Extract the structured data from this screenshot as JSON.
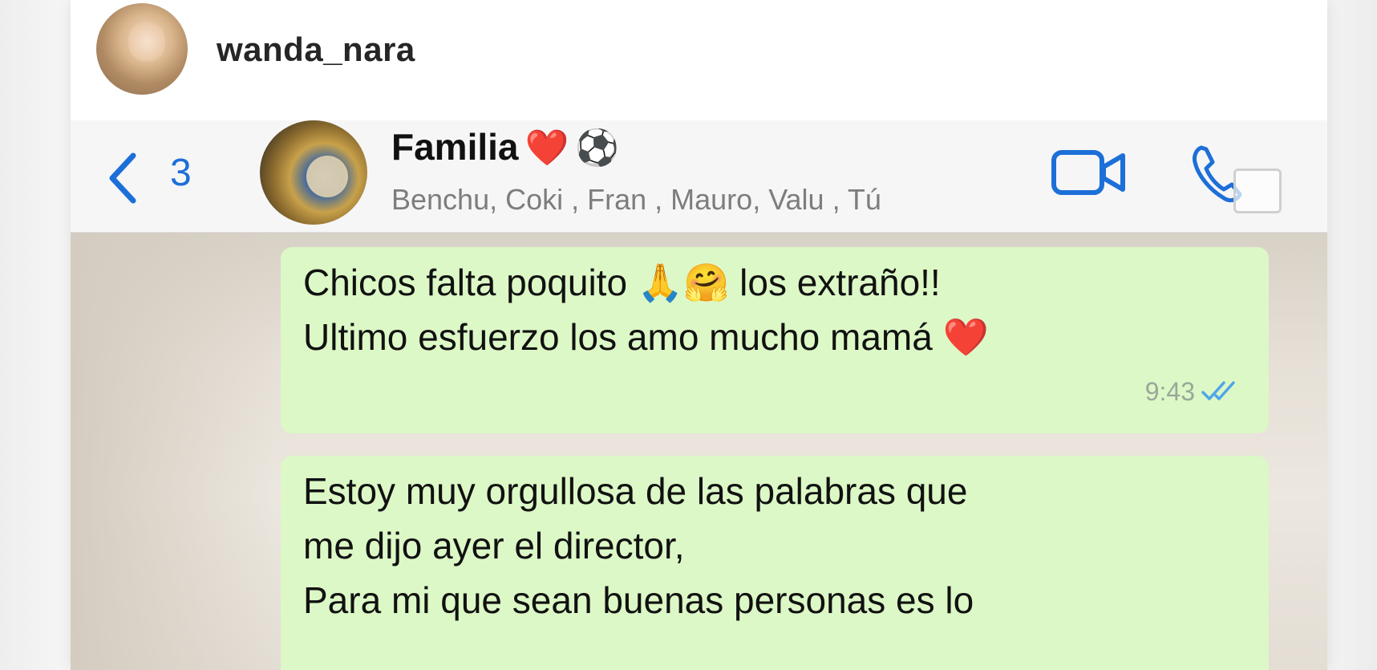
{
  "story": {
    "username": "wanda_nara"
  },
  "chat_header": {
    "back_count": "3",
    "group_name": "Familia",
    "group_emojis": [
      "❤️",
      "⚽"
    ],
    "members": "Benchu, Coki , Fran , Mauro, Valu , Tú"
  },
  "icons": {
    "back": "chevron-left-icon",
    "video": "video-camera-icon",
    "call": "phone-icon"
  },
  "colors": {
    "accent": "#1d6fd8",
    "bubble_out": "#dcf8c6",
    "read_ticks": "#4fa6e8"
  },
  "messages": [
    {
      "text": "Chicos falta poquito 🙏🤗 los extraño!!\nUltimo esfuerzo los amo mucho mamá ❤️",
      "time": "9:43",
      "status": "read"
    },
    {
      "text": "Estoy muy orgullosa de las palabras que\nme dijo ayer el director,\nPara mi que sean buenas personas es lo",
      "time": "",
      "status": ""
    }
  ]
}
